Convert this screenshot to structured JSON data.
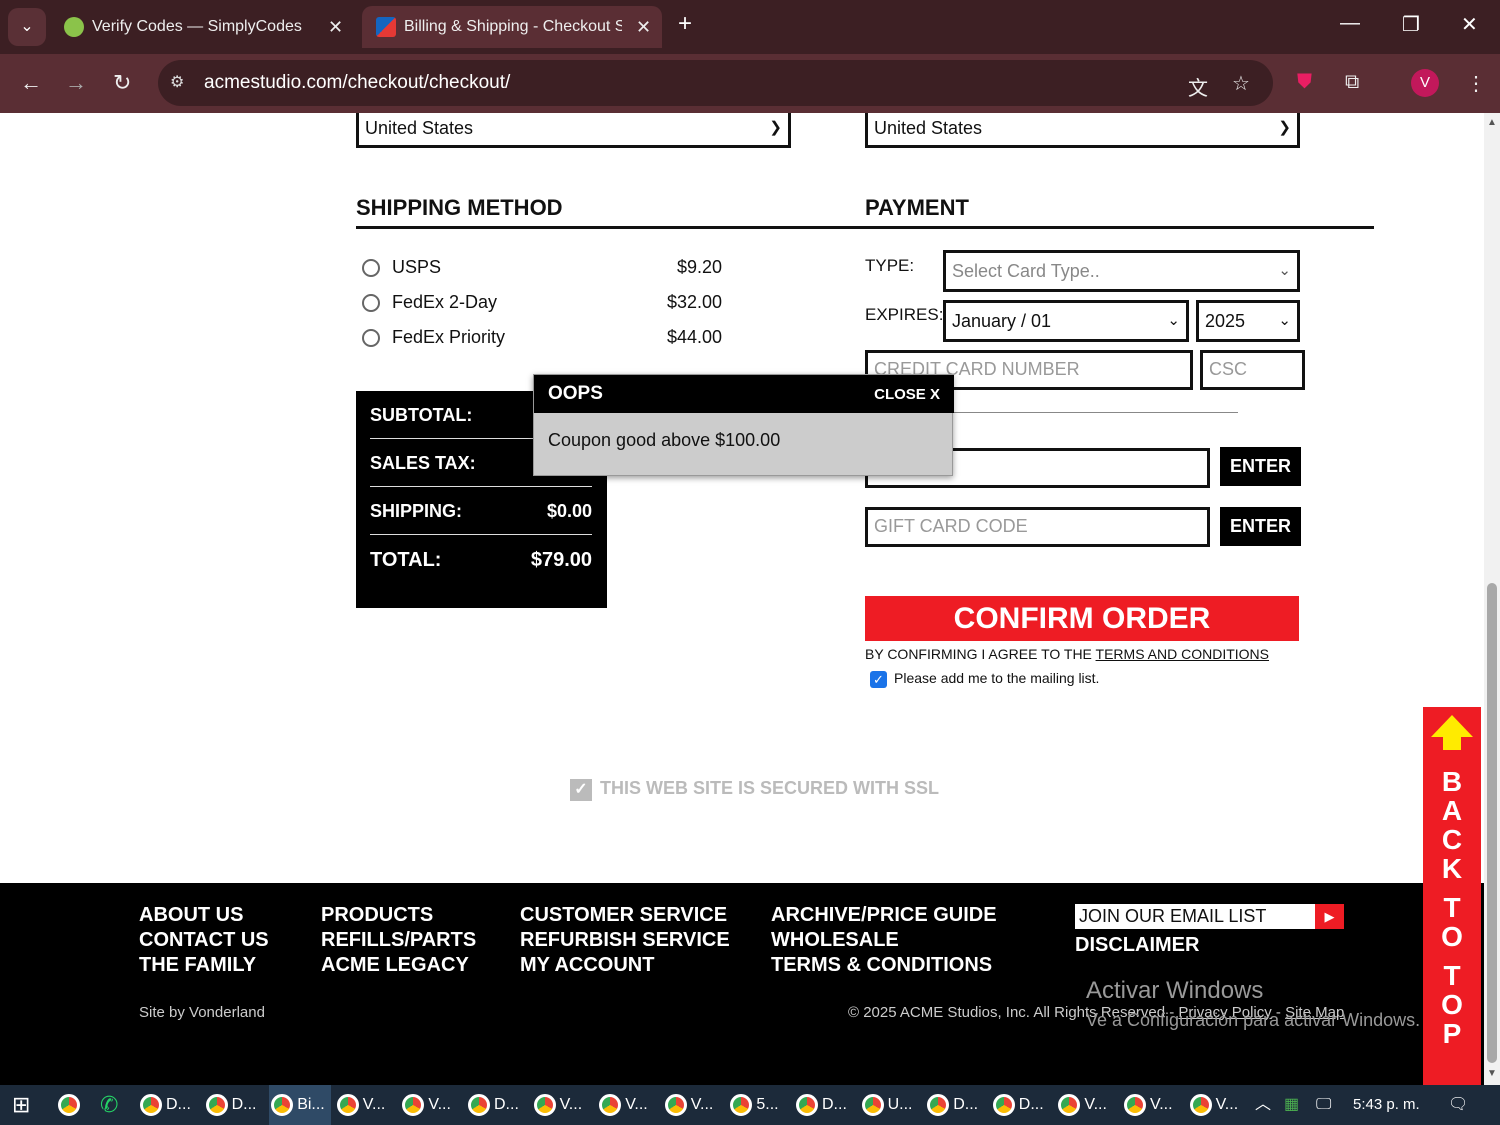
{
  "browser": {
    "tabs": [
      {
        "title": "Verify Codes — SimplyCodes",
        "favicon_color": "#8bc34a"
      },
      {
        "title": "Billing & Shipping - Checkout S",
        "favicon_color": "#1565c0",
        "active": true
      }
    ],
    "url": "acmestudio.com/checkout/checkout/",
    "profile_initial": "V"
  },
  "country": {
    "billing": "United States",
    "shipping": "United States"
  },
  "shipping_method": {
    "title": "SHIPPING METHOD",
    "options": [
      {
        "label": "USPS",
        "price": "$9.20"
      },
      {
        "label": "FedEx 2-Day",
        "price": "$32.00"
      },
      {
        "label": "FedEx Priority",
        "price": "$44.00"
      }
    ]
  },
  "payment": {
    "title": "PAYMENT",
    "type_label": "TYPE:",
    "type_placeholder": "Select Card Type..",
    "expires_label": "EXPIRES:",
    "expires_month": "January / 01",
    "expires_year": "2025",
    "card_number_placeholder": "CREDIT CARD NUMBER",
    "csc_placeholder": "CSC",
    "coupon_enter": "ENTER",
    "gift_placeholder": "GIFT CARD CODE",
    "gift_enter": "ENTER"
  },
  "totals": {
    "subtotal_label": "SUBTOTAL:",
    "tax_label": "SALES TAX:",
    "shipping_label": "SHIPPING:",
    "shipping_value": "$0.00",
    "total_label": "TOTAL:",
    "total_value": "$79.00"
  },
  "modal": {
    "title": "OOPS",
    "close": "CLOSE X",
    "message": "Coupon good above $100.00"
  },
  "confirm": {
    "button": "CONFIRM ORDER",
    "terms_prefix": "BY CONFIRMING I AGREE TO THE ",
    "terms_link": "TERMS AND CONDITIONS",
    "mailing": "Please add me to the mailing list."
  },
  "ssl": "THIS WEB SITE IS SECURED WITH SSL",
  "footer": {
    "col1": [
      "ABOUT US",
      "CONTACT US",
      "THE FAMILY"
    ],
    "col2": [
      "PRODUCTS",
      "REFILLS/PARTS",
      "ACME LEGACY"
    ],
    "col3": [
      "CUSTOMER SERVICE",
      "REFURBISH SERVICE",
      "MY ACCOUNT"
    ],
    "col4": [
      "ARCHIVE/PRICE GUIDE",
      "WHOLESALE",
      "TERMS & CONDITIONS"
    ],
    "email_placeholder": "JOIN OUR EMAIL LIST",
    "disclaimer": "DISCLAIMER",
    "site_by": "Site by Vonderland",
    "copyright": "© 2025 ACME Studios, Inc. All Rights Reserved",
    "privacy": "Privacy Policy",
    "sitemap": "Site Map",
    "activate_title": "Activar Windows",
    "activate_sub": "Ve a Configuración para activar Windows."
  },
  "back_to_top": [
    "B",
    "A",
    "C",
    "K",
    "",
    "T",
    "O",
    "",
    "T",
    "O",
    "P"
  ],
  "taskbar": {
    "items": [
      "D...",
      "D...",
      "Bi...",
      "V...",
      "V...",
      "D...",
      "V...",
      "V...",
      "V...",
      "5...",
      "D...",
      "U...",
      "D...",
      "D...",
      "V...",
      "V...",
      "V..."
    ],
    "clock": "5:43 p. m."
  }
}
